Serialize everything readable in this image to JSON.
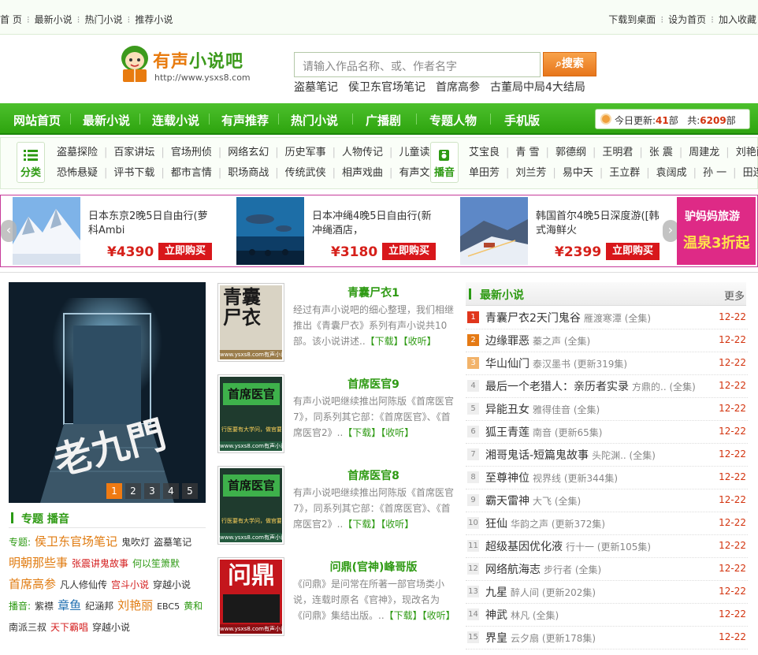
{
  "topbar": {
    "left": [
      "首 页",
      "最新小说",
      "热门小说",
      "推荐小说"
    ],
    "right": [
      "下载到桌面",
      "设为首页",
      "加入收藏"
    ]
  },
  "logo": {
    "text_orange": "有声",
    "text_green": "小说吧",
    "url": "http://www.ysxs8.com"
  },
  "search": {
    "placeholder": "请输入作品名称、或、作者名字",
    "button": "搜索"
  },
  "hot_keywords": [
    "盗墓笔记",
    "侯卫东官场笔记",
    "首席高参",
    "古董局中局4大结局"
  ],
  "nav": [
    "网站首页",
    "最新小说",
    "连载小说",
    "有声推荐",
    "热门小说",
    "广播剧",
    "专题人物",
    "手机版"
  ],
  "update": {
    "label1": "今日更新:",
    "today": "41",
    "unit1": "部",
    "label2": "共:",
    "total": "6209",
    "unit2": "部"
  },
  "categories": {
    "label": "分类",
    "row1": [
      "盗墓探险",
      "百家讲坛",
      "官场刑侦",
      "网络玄幻",
      "历史军事",
      "人物传记",
      "儿童读物"
    ],
    "row2": [
      "恐怖悬疑",
      "评书下载",
      "都市言情",
      "职场商战",
      "传统武侠",
      "相声戏曲",
      "有声文学"
    ]
  },
  "anchors": {
    "label": "播音",
    "row1": [
      "艾宝良",
      "青 雪",
      "郭德纲",
      "王明君",
      "张 震",
      "周建龙",
      "刘艳丽"
    ],
    "row2": [
      "单田芳",
      "刘兰芳",
      "易中天",
      "王立群",
      "袁阔成",
      "孙 一",
      "田连元"
    ]
  },
  "ads": [
    {
      "title": "日本东京2晚5日自由行(萝科Ambi",
      "price": "¥4390",
      "button": "立即购买"
    },
    {
      "title": "日本冲绳4晚5日自由行(新冲绳酒店，",
      "price": "¥3180",
      "button": "立即购买"
    },
    {
      "title": "韩国首尔4晚5日深度游([韩式海鲜火",
      "price": "¥2399",
      "button": "立即购买"
    }
  ],
  "promo": {
    "line1": "驴妈妈旅游",
    "line2": "温泉3折起"
  },
  "slider": {
    "dots": [
      "1",
      "2",
      "3",
      "4",
      "5"
    ],
    "active": 1
  },
  "special": {
    "title": "专题 播音",
    "line1_label": "专题:",
    "tags": [
      "侯卫东官场笔记",
      "鬼吹灯",
      "盗墓笔记",
      "明朝那些事",
      "张震讲鬼故事",
      "何以笙箫默",
      "首席高参",
      "凡人修仙传",
      "宫斗小说",
      "穿越小说"
    ],
    "anchor_label": "播音:",
    "anchors": [
      "紫襟",
      "章鱼",
      "纪涵邦",
      "刘艳丽",
      "EBC5",
      "黄和",
      "南派三叔",
      "天下霸唱",
      "穿越小说"
    ]
  },
  "books": [
    {
      "title": "青囊尸衣1",
      "desc": "经过有声小说吧的细心整理，我们相继推出《青囊尸衣》系列有声小说共10部。该小说讲述..",
      "download": "【下载】",
      "collect": "【收听】"
    },
    {
      "title": "首席医官9",
      "desc": "有声小说吧继续推出阿陈版《首席医官7》，同系列其它部：《首席医官》、《首席医官2》..",
      "download": "【下载】",
      "collect": "【收听】"
    },
    {
      "title": "首席医官8",
      "desc": "有声小说吧继续推出阿陈版《首席医官7》，同系列其它部：《首席医官》、《首席医官2》..",
      "download": "【下载】",
      "collect": "【收听】"
    },
    {
      "title": "问鼎(官神)峰哥版",
      "desc": "《问鼎》是问常在所著一部官场类小说，连载时原名《官神》，现改名为《问鼎》集结出版。..",
      "download": "【下载】",
      "collect": "【收听】"
    }
  ],
  "covers": [
    {
      "big": "青囊尸衣",
      "site": "www.ysxs8.com有声小说"
    },
    {
      "big": "首席医官",
      "sub": "行医要有大学问，做官要有大智慧",
      "site": "www.ysxs8.com有声小说"
    },
    {
      "big": "首席医官",
      "sub": "行医要有大学问，做官要有大智慧",
      "site": "www.ysxs8.com有声小说"
    },
    {
      "big": "问鼎",
      "site": "www.ysxs8.com有声小说"
    }
  ],
  "latest": {
    "title": "最新小说",
    "more": "更多",
    "items": [
      {
        "no": "1",
        "name": "青囊尸衣2天门鬼谷",
        "info": "雁渡寒潭 (全集)",
        "date": "12-22"
      },
      {
        "no": "2",
        "name": "边缘罪恶",
        "info": "蓁之声 (全集)",
        "date": "12-22"
      },
      {
        "no": "3",
        "name": "华山仙门",
        "info": "泰汉墨书 (更新319集)",
        "date": "12-22"
      },
      {
        "no": "4",
        "name": "最后一个老猎人：亲历者实录",
        "info": "方鼎的.. (全集)",
        "date": "12-22"
      },
      {
        "no": "5",
        "name": "异能丑女",
        "info": "雅得佳音 (全集)",
        "date": "12-22"
      },
      {
        "no": "6",
        "name": "狐王青莲",
        "info": "南音 (更新65集)",
        "date": "12-22"
      },
      {
        "no": "7",
        "name": "湘哥鬼话-短篇鬼故事",
        "info": "头陀渊.. (全集)",
        "date": "12-22"
      },
      {
        "no": "8",
        "name": "至尊神位",
        "info": "视界线 (更新344集)",
        "date": "12-22"
      },
      {
        "no": "9",
        "name": "霸天雷神",
        "info": "大飞 (全集)",
        "date": "12-22"
      },
      {
        "no": "10",
        "name": "狂仙",
        "info": "华韵之声 (更新372集)",
        "date": "12-22"
      },
      {
        "no": "11",
        "name": "超级基因优化液",
        "info": "行十一 (更新105集)",
        "date": "12-22"
      },
      {
        "no": "12",
        "name": "网络航海志",
        "info": "步行者 (全集)",
        "date": "12-22"
      },
      {
        "no": "13",
        "name": "九星",
        "info": "醉人间 (更新202集)",
        "date": "12-22"
      },
      {
        "no": "14",
        "name": "神武",
        "info": "林凡 (全集)",
        "date": "12-22"
      },
      {
        "no": "15",
        "name": "界皇",
        "info": "云夕扇 (更新178集)",
        "date": "12-22"
      }
    ]
  },
  "colors": {
    "brand_green": "#2e9a13",
    "nav_green": "#3db31e",
    "accent_orange": "#e87b0f",
    "price_red": "#d6201a",
    "promo_pink": "#de2a86"
  }
}
